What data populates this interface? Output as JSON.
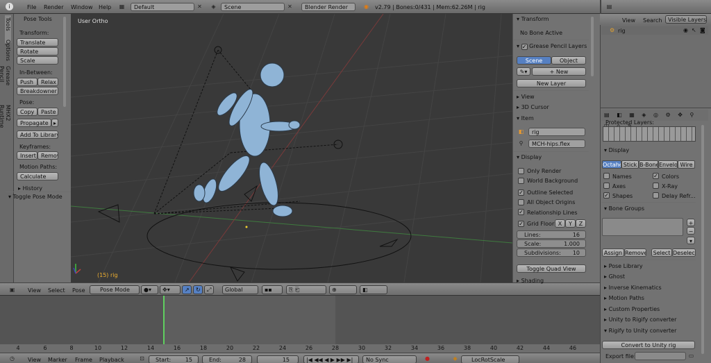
{
  "topbar": {
    "menus": [
      "File",
      "Render",
      "Window",
      "Help"
    ],
    "layout": "Default",
    "scene": "Scene",
    "engine": "Blender Render",
    "stats": "v2.79 | Bones:0/431 | Mem:62.26M | rig"
  },
  "tools_tabs": [
    "Tools",
    "Options",
    "Grease Pencil",
    "MHX2 Runtime"
  ],
  "tools": {
    "title": "Pose Tools",
    "transform_label": "Transform:",
    "translate": "Translate",
    "rotate": "Rotate",
    "scale": "Scale",
    "inbetween_label": "In-Between:",
    "push": "Push",
    "relax": "Relax",
    "breakdowner": "Breakdowner",
    "pose_label": "Pose:",
    "copy": "Copy",
    "paste": "Paste",
    "propagate": "Propagate",
    "add_library": "Add To Library",
    "keyframes_label": "Keyframes:",
    "insert": "Insert",
    "remove": "Remov",
    "motion_label": "Motion Paths:",
    "calculate": "Calculate",
    "history": "History",
    "toggle_pose": "Toggle Pose Mode"
  },
  "viewport": {
    "view_name": "User Ortho",
    "object_label": "(15) rig"
  },
  "vp_header": {
    "view": "View",
    "select": "Select",
    "pose": "Pose",
    "mode": "Pose Mode",
    "orientation": "Global"
  },
  "props": {
    "transform": "Transform",
    "no_bone": "No Bone Active",
    "gp_layers": "Grease Pencil Layers",
    "scene_tab": "Scene",
    "object_tab": "Object",
    "new": "New",
    "new_layer": "New Layer",
    "view": "View",
    "cursor": "3D Cursor",
    "item": "Item",
    "item_name": "rig",
    "bone_name": "MCH-hips.flex",
    "display": "Display",
    "only_render": "Only Render",
    "world_bg": "World Background",
    "outline_sel": "Outline Selected",
    "all_origins": "All Object Origins",
    "rel_lines": "Relationship Lines",
    "grid_floor": "Grid Floor",
    "axis_x": "X",
    "axis_y": "Y",
    "axis_z": "Z",
    "lines_label": "Lines:",
    "lines_val": "16",
    "scale_label": "Scale:",
    "scale_val": "1.000",
    "subdiv_label": "Subdivisions:",
    "subdiv_val": "10",
    "toggle_quad": "Toggle Quad View",
    "shading": "Shading"
  },
  "outliner": {
    "view": "View",
    "search": "Search",
    "visible_layers": "Visible Layers",
    "item": "rig"
  },
  "armature": {
    "protected": "Protected Layers:",
    "display": "Display",
    "draw_types": [
      "Octahe",
      "Stick",
      "B-Bone",
      "Envelo",
      "Wire"
    ],
    "names": "Names",
    "colors": "Colors",
    "axes": "Axes",
    "xray": "X-Ray",
    "shapes": "Shapes",
    "delay": "Delay Refr...",
    "bone_groups": "Bone Groups",
    "assign": "Assign",
    "remove": "Remove",
    "select": "Select",
    "deselect": "Deselect",
    "panels": [
      "Pose Library",
      "Ghost",
      "Inverse Kinematics",
      "Motion Paths",
      "Custom Properties",
      "Unity to Rigify converter",
      "Rigify to Unity converter"
    ],
    "convert": "Convert to Unity rig",
    "export_label": "Export file:"
  },
  "timeline": {
    "ticks": [
      "4",
      "6",
      "8",
      "10",
      "12",
      "14",
      "16",
      "18",
      "20",
      "22",
      "24",
      "26",
      "28",
      "30",
      "32",
      "34",
      "36",
      "38",
      "40",
      "42",
      "44",
      "46"
    ],
    "view": "View",
    "marker": "Marker",
    "frame": "Frame",
    "playback": "Playback",
    "start_label": "Start:",
    "start_val": "15",
    "end_label": "End:",
    "end_val": "28",
    "current": "15",
    "sync": "No Sync",
    "keying": "LocRotScale"
  },
  "colors": {
    "viewport": "#393939",
    "panel": "#727272",
    "header": "#727272",
    "accent": "#5680c2",
    "playhead": "#60d060"
  }
}
